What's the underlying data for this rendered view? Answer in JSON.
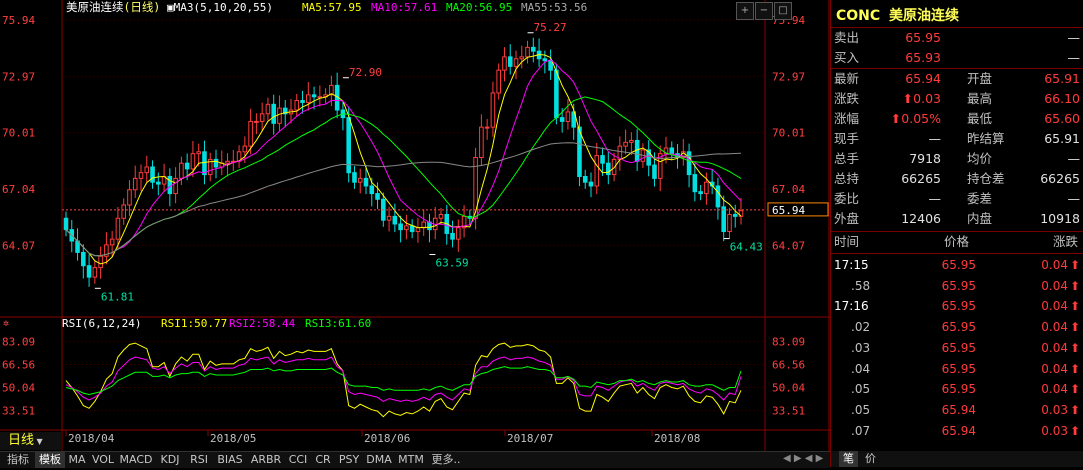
{
  "header": {
    "title": "美原油连续",
    "period": "(日线)",
    "ma_group": "MA3(5,10,20,55)",
    "ma5": "MA5:57.95",
    "ma10": "MA10:57.61",
    "ma20": "MA20:56.95",
    "ma55": "MA55:53.56"
  },
  "indicator": {
    "name": "RSI(6,12,24)",
    "rsi1": "RSI1:50.77",
    "rsi2": "RSI2:58.44",
    "rsi3": "RSI3:61.60"
  },
  "period_button": "日线",
  "current_price_tag": "65.94",
  "colors": {
    "up": "#ff3b3b",
    "down": "#00e0e0",
    "ma5": "#ffffff",
    "ma10": "#ffff00",
    "ma20": "#ff00ff",
    "ma55": "#00ff00",
    "ma60": "#888888"
  },
  "quote": {
    "code": "CONC",
    "name": "美原油连续",
    "rows": [
      {
        "l1": "卖出",
        "v1": "65.95",
        "l2": "",
        "v2": "—"
      },
      {
        "l1": "买入",
        "v1": "65.93",
        "l2": "",
        "v2": "—"
      },
      {
        "l1": "最新",
        "v1": "65.94",
        "l2": "开盘",
        "v2": "65.91"
      },
      {
        "l1": "涨跌",
        "v1": "0.03",
        "l2": "最高",
        "v2": "66.10"
      },
      {
        "l1": "涨幅",
        "v1": "0.05%",
        "l2": "最低",
        "v2": "65.60"
      },
      {
        "l1": "现手",
        "v1": "—",
        "l2": "昨结算",
        "v2": "65.91"
      },
      {
        "l1": "总手",
        "v1": "7918",
        "l2": "均价",
        "v2": "—"
      },
      {
        "l1": "总持",
        "v1": "66265",
        "l2": "持仓差",
        "v2": "66265"
      },
      {
        "l1": "委比",
        "v1": "—",
        "l2": "委差",
        "v2": "—"
      },
      {
        "l1": "外盘",
        "v1": "12406",
        "l2": "内盘",
        "v2": "10918"
      }
    ],
    "ticks_header": {
      "time": "时间",
      "price": "价格",
      "change": "涨跌"
    },
    "ticks": [
      {
        "time": "17:15",
        "price": "65.95",
        "change": "0.04"
      },
      {
        "time": ".58",
        "price": "65.95",
        "change": "0.04"
      },
      {
        "time": "17:16",
        "price": "65.95",
        "change": "0.04"
      },
      {
        "time": ".02",
        "price": "65.95",
        "change": "0.04"
      },
      {
        "time": ".03",
        "price": "65.95",
        "change": "0.04"
      },
      {
        "time": ".04",
        "price": "65.95",
        "change": "0.04"
      },
      {
        "time": ".05",
        "price": "65.95",
        "change": "0.04"
      },
      {
        "time": ".05",
        "price": "65.94",
        "change": "0.03"
      },
      {
        "time": ".07",
        "price": "65.94",
        "change": "0.03"
      }
    ],
    "footer": {
      "t1": "笔",
      "t2": "价"
    }
  },
  "bottom_tabs": [
    "指标",
    "模板",
    "MA",
    "VOL",
    "MACD",
    "KDJ",
    "RSI",
    "BIAS",
    "ARBR",
    "CCI",
    "CR",
    "PSY",
    "DMA",
    "MTM",
    "更多.."
  ],
  "chart_data": {
    "type": "candlestick",
    "title": "美原油连续(日线)",
    "price_axis": [
      "75.94",
      "72.97",
      "70.01",
      "67.04",
      "64.07"
    ],
    "price_range": [
      61.3,
      76.1
    ],
    "x_labels": [
      "2018/04",
      "2018/05",
      "2018/06",
      "2018/07",
      "2018/08"
    ],
    "annotations": [
      {
        "label": "72.90",
        "value": 72.9
      },
      {
        "label": "61.81",
        "value": 61.81
      },
      {
        "label": "63.59",
        "value": 63.59
      },
      {
        "label": "75.27",
        "value": 75.27
      },
      {
        "label": "64.43",
        "value": 64.43
      }
    ],
    "last_price": 65.94,
    "closes": [
      64.9,
      64.3,
      63.7,
      63.0,
      62.4,
      62.9,
      63.5,
      64.1,
      64.4,
      65.5,
      66.2,
      67.0,
      67.6,
      67.9,
      68.2,
      67.4,
      67.3,
      67.7,
      66.8,
      67.6,
      68.4,
      68.1,
      68.9,
      69.0,
      67.8,
      68.6,
      68.2,
      68.4,
      68.5,
      68.5,
      69.0,
      69.3,
      70.6,
      70.6,
      71.0,
      71.5,
      70.5,
      71.3,
      71.0,
      71.2,
      71.7,
      71.6,
      72.0,
      71.9,
      71.9,
      72.0,
      72.5,
      71.2,
      70.8,
      67.9,
      67.4,
      67.6,
      67.2,
      66.8,
      66.5,
      65.4,
      65.6,
      65.2,
      64.9,
      65.1,
      64.8,
      65.0,
      65.3,
      64.9,
      65.5,
      65.7,
      64.7,
      64.4,
      65.0,
      65.6,
      65.5,
      68.7,
      70.3,
      70.3,
      72.1,
      73.3,
      74.0,
      73.5,
      73.9,
      74.0,
      74.5,
      74.3,
      73.9,
      73.8,
      73.3,
      70.8,
      70.6,
      71.1,
      70.3,
      67.7,
      67.4,
      67.2,
      68.8,
      68.4,
      67.8,
      68.6,
      69.3,
      69.5,
      69.6,
      68.5,
      69.1,
      68.3,
      67.6,
      68.9,
      69.2,
      68.9,
      68.7,
      69.0,
      67.8,
      66.9,
      66.8,
      67.4,
      67.2,
      66.1,
      64.8,
      65.7,
      65.6,
      65.9
    ],
    "rsi_axis": [
      "83.09",
      "66.56",
      "50.04",
      "33.51"
    ],
    "rsi_range": [
      23,
      90
    ],
    "rsi1": [
      55,
      50,
      44,
      37,
      35,
      40,
      47,
      56,
      60,
      72,
      77,
      81,
      82,
      80,
      78,
      65,
      65,
      68,
      58,
      67,
      72,
      69,
      74,
      74,
      63,
      69,
      66,
      67,
      67,
      67,
      70,
      71,
      78,
      76,
      77,
      79,
      71,
      76,
      73,
      74,
      76,
      75,
      77,
      76,
      76,
      76,
      78,
      67,
      62,
      37,
      35,
      38,
      36,
      34,
      33,
      29,
      33,
      31,
      30,
      32,
      31,
      33,
      36,
      33,
      40,
      42,
      36,
      34,
      40,
      46,
      45,
      66,
      73,
      72,
      78,
      81,
      82,
      79,
      80,
      80,
      81,
      80,
      77,
      76,
      72,
      53,
      53,
      57,
      53,
      35,
      33,
      33,
      45,
      43,
      40,
      46,
      51,
      52,
      53,
      46,
      50,
      45,
      42,
      50,
      52,
      50,
      49,
      51,
      44,
      40,
      39,
      44,
      43,
      38,
      31,
      40,
      39,
      48
    ],
    "rsi2": [
      52,
      50,
      47,
      43,
      41,
      43,
      46,
      51,
      54,
      62,
      66,
      70,
      72,
      71,
      70,
      64,
      63,
      65,
      60,
      64,
      67,
      65,
      68,
      68,
      62,
      65,
      63,
      64,
      64,
      64,
      66,
      67,
      71,
      70,
      71,
      72,
      67,
      70,
      68,
      69,
      70,
      70,
      71,
      70,
      70,
      70,
      72,
      65,
      62,
      47,
      45,
      46,
      45,
      44,
      43,
      40,
      42,
      41,
      40,
      41,
      40,
      41,
      43,
      41,
      45,
      46,
      43,
      41,
      45,
      49,
      48,
      60,
      65,
      65,
      69,
      71,
      72,
      70,
      71,
      71,
      72,
      71,
      69,
      68,
      66,
      56,
      56,
      58,
      55,
      45,
      44,
      44,
      51,
      50,
      48,
      51,
      54,
      55,
      55,
      51,
      53,
      50,
      48,
      53,
      54,
      53,
      52,
      53,
      49,
      47,
      46,
      49,
      48,
      45,
      41,
      46,
      45,
      58
    ],
    "rsi3": [
      50,
      49,
      48,
      46,
      45,
      46,
      47,
      49,
      51,
      55,
      57,
      59,
      61,
      61,
      61,
      58,
      58,
      59,
      57,
      59,
      60,
      60,
      61,
      61,
      58,
      60,
      59,
      59,
      59,
      59,
      60,
      61,
      63,
      63,
      63,
      64,
      62,
      63,
      62,
      62,
      63,
      63,
      63,
      63,
      63,
      63,
      64,
      61,
      59,
      52,
      51,
      51,
      51,
      50,
      50,
      48,
      49,
      48,
      48,
      48,
      48,
      48,
      49,
      48,
      50,
      51,
      49,
      48,
      50,
      52,
      52,
      58,
      60,
      61,
      63,
      64,
      65,
      64,
      64,
      64,
      65,
      64,
      63,
      63,
      62,
      57,
      57,
      58,
      56,
      51,
      51,
      50,
      54,
      53,
      52,
      53,
      55,
      55,
      56,
      54,
      55,
      53,
      52,
      54,
      55,
      54,
      54,
      55,
      52,
      51,
      51,
      52,
      52,
      50,
      48,
      50,
      50,
      62
    ]
  }
}
